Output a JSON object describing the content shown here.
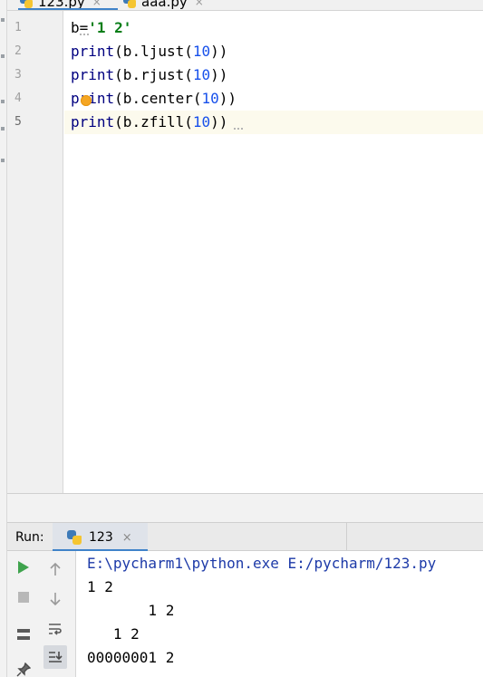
{
  "tabs": [
    {
      "label": "123.py",
      "close": "×"
    },
    {
      "label": "aaa.py",
      "close": "×"
    }
  ],
  "editor": {
    "line_numbers": [
      "1",
      "2",
      "3",
      "4",
      "5"
    ],
    "lines": [
      {
        "segments": [
          {
            "t": "b=",
            "c": "plain"
          },
          {
            "t": "'1 2'",
            "c": "str"
          }
        ]
      },
      {
        "segments": [
          {
            "t": "print",
            "c": "kw"
          },
          {
            "t": "(b.ljust(",
            "c": "plain"
          },
          {
            "t": "10",
            "c": "num"
          },
          {
            "t": "))",
            "c": "plain"
          }
        ]
      },
      {
        "segments": [
          {
            "t": "print",
            "c": "kw"
          },
          {
            "t": "(b.rjust(",
            "c": "plain"
          },
          {
            "t": "10",
            "c": "num"
          },
          {
            "t": "))",
            "c": "plain"
          }
        ]
      },
      {
        "segments": [
          {
            "t": "print",
            "c": "kw"
          },
          {
            "t": "(b.center(",
            "c": "plain"
          },
          {
            "t": "10",
            "c": "num"
          },
          {
            "t": "))",
            "c": "plain"
          }
        ]
      },
      {
        "segments": [
          {
            "t": "print",
            "c": "kw"
          },
          {
            "t": "(b.zfill(",
            "c": "plain"
          },
          {
            "t": "10",
            "c": "num"
          },
          {
            "t": "))",
            "c": "plain"
          }
        ]
      }
    ],
    "current_line": 5
  },
  "run": {
    "label": "Run:",
    "tab_label": "123",
    "tab_close": "×",
    "output": [
      "E:\\pycharm1\\python.exe E:/pycharm/123.py",
      "1 2",
      "       1 2",
      "   1 2",
      "00000001 2"
    ]
  },
  "toolbar": {
    "rerun_icon": "play-icon",
    "stop_icon": "stop-icon",
    "up_icon": "arrow-up-icon",
    "down_icon": "arrow-down-icon",
    "wrap_icon": "soft-wrap-icon",
    "scroll_icon": "scroll-to-end-icon",
    "layout_icon": "layout-icon",
    "pin_icon": "pin-icon"
  },
  "colors": {
    "keyword": "#000080",
    "string": "#067d17",
    "number": "#1750eb",
    "console_command": "#1d3aa8",
    "accent": "#4083c9",
    "run_green": "#3fa34d"
  }
}
